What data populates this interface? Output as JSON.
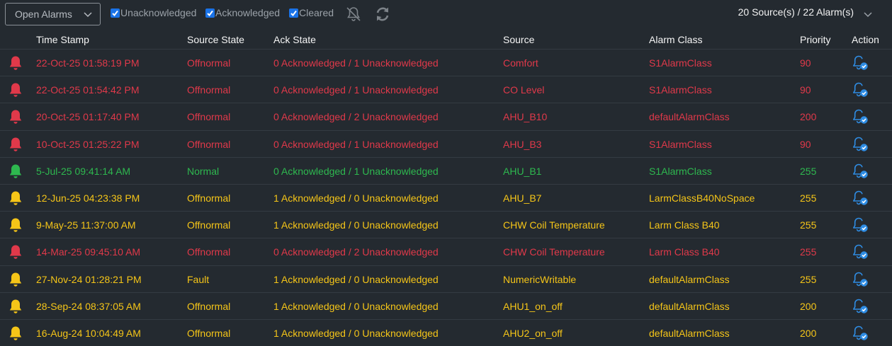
{
  "toolbar": {
    "view_select": "Open Alarms",
    "filters": [
      {
        "label": "Unacknowledged",
        "checked": true
      },
      {
        "label": "Acknowledged",
        "checked": true
      },
      {
        "label": "Cleared",
        "checked": true
      }
    ],
    "icons": [
      "bell-slash-icon",
      "refresh-icon"
    ],
    "summary": "20 Source(s) / 22 Alarm(s)"
  },
  "colors": {
    "background": "#242a30",
    "alarm_red": "#e0394a",
    "normal_green": "#2eb84f",
    "fault_yellow": "#f5c518",
    "accent_blue": "#1a73e8"
  },
  "table": {
    "columns": [
      "Time Stamp",
      "Source State",
      "Ack State",
      "Source",
      "Alarm Class",
      "Priority",
      "Action"
    ],
    "rows": [
      {
        "status": "red",
        "timestamp": "22-Oct-25 01:58:19 PM",
        "source_state": "Offnormal",
        "ack_state": "0 Acknowledged / 1 Unacknowledged",
        "source": "Comfort",
        "alarm_class": "S1AlarmClass",
        "priority": "90"
      },
      {
        "status": "red",
        "timestamp": "22-Oct-25 01:54:42 PM",
        "source_state": "Offnormal",
        "ack_state": "0 Acknowledged / 1 Unacknowledged",
        "source": "CO Level",
        "alarm_class": "S1AlarmClass",
        "priority": "90"
      },
      {
        "status": "red",
        "timestamp": "20-Oct-25 01:17:40 PM",
        "source_state": "Offnormal",
        "ack_state": "0 Acknowledged / 2 Unacknowledged",
        "source": "AHU_B10",
        "alarm_class": "defaultAlarmClass",
        "priority": "200"
      },
      {
        "status": "red",
        "timestamp": "10-Oct-25 01:25:22 PM",
        "source_state": "Offnormal",
        "ack_state": "0 Acknowledged / 1 Unacknowledged",
        "source": "AHU_B3",
        "alarm_class": "S1AlarmClass",
        "priority": "90"
      },
      {
        "status": "green",
        "timestamp": "5-Jul-25 09:41:14 AM",
        "source_state": "Normal",
        "ack_state": "0 Acknowledged / 1 Unacknowledged",
        "source": "AHU_B1",
        "alarm_class": "S1AlarmClass",
        "priority": "255"
      },
      {
        "status": "yellow",
        "timestamp": "12-Jun-25 04:23:38 PM",
        "source_state": "Offnormal",
        "ack_state": "1 Acknowledged / 0 Unacknowledged",
        "source": "AHU_B7",
        "alarm_class": "LarmClassB40NoSpace",
        "priority": "255"
      },
      {
        "status": "yellow",
        "timestamp": "9-May-25 11:37:00 AM",
        "source_state": "Offnormal",
        "ack_state": "1 Acknowledged / 0 Unacknowledged",
        "source": "CHW Coil Temperature",
        "alarm_class": "Larm Class B40",
        "priority": "255"
      },
      {
        "status": "red",
        "timestamp": "14-Mar-25 09:45:10 AM",
        "source_state": "Offnormal",
        "ack_state": "0 Acknowledged / 2 Unacknowledged",
        "source": "CHW Coil Temperature",
        "alarm_class": "Larm Class B40",
        "priority": "255"
      },
      {
        "status": "yellow",
        "timestamp": "27-Nov-24 01:28:21 PM",
        "source_state": "Fault",
        "ack_state": "1 Acknowledged / 0 Unacknowledged",
        "source": "NumericWritable",
        "alarm_class": "defaultAlarmClass",
        "priority": "255"
      },
      {
        "status": "yellow",
        "timestamp": "28-Sep-24 08:37:05 AM",
        "source_state": "Offnormal",
        "ack_state": "1 Acknowledged / 0 Unacknowledged",
        "source": "AHU1_on_off",
        "alarm_class": "defaultAlarmClass",
        "priority": "200"
      },
      {
        "status": "yellow",
        "timestamp": "16-Aug-24 10:04:49 AM",
        "source_state": "Offnormal",
        "ack_state": "1 Acknowledged / 0 Unacknowledged",
        "source": "AHU2_on_off",
        "alarm_class": "defaultAlarmClass",
        "priority": "200"
      }
    ]
  }
}
